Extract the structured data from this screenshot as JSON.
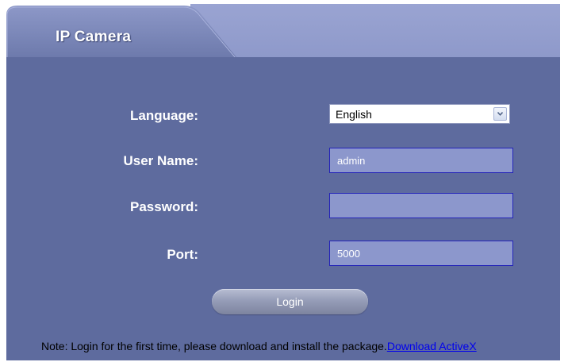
{
  "header": {
    "tab_title": "IP Camera"
  },
  "form": {
    "language": {
      "label": "Language:",
      "selected": "English"
    },
    "username": {
      "label": "User Name:",
      "value": "admin"
    },
    "password": {
      "label": "Password:",
      "value": ""
    },
    "port": {
      "label": "Port:",
      "value": "5000"
    },
    "login_label": "Login"
  },
  "footer": {
    "note_text": "Note: Login for the first time, please download and install the package.",
    "download_link": "Download ActiveX"
  },
  "colors": {
    "panel": "#5e6b9e",
    "tab": "#7b87b9",
    "top_band": "#9aa4d2",
    "field_fill": "#8c97cc",
    "field_border": "#2323b8",
    "link": "#0000ee"
  },
  "icons": {
    "select_arrow": "chevron-down-icon"
  }
}
